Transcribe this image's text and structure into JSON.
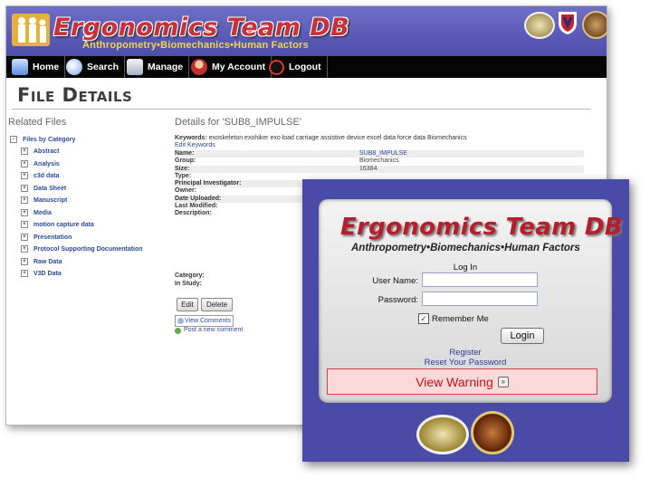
{
  "banner": {
    "title": "Ergonomics Team DB",
    "subtitle": "Anthropometry•Biomechanics•Human Factors"
  },
  "nav": [
    {
      "label": "Home",
      "icon": "home-icon"
    },
    {
      "label": "Search",
      "icon": "search-icon"
    },
    {
      "label": "Manage",
      "icon": "manage-icon"
    },
    {
      "label": "My Account",
      "icon": "account-icon"
    },
    {
      "label": "Logout",
      "icon": "logout-icon"
    }
  ],
  "page": {
    "title": "File Details",
    "related_title": "Related Files",
    "details_title": "Details for 'SUB8_IMPULSE'"
  },
  "tree": {
    "root": "Files by Category",
    "items": [
      "Abstract",
      "Analysis",
      "c3d data",
      "Data Sheet",
      "Manuscript",
      "Media",
      "motion capture data",
      "Presentation",
      "Protocol Supporting Documentation",
      "Raw Data",
      "V3D Data"
    ]
  },
  "details": {
    "keywords_label": "Keywords:",
    "keywords": "exoskeleton exohiker exo load carriage assistive device excel data force data Biomechanics",
    "edit_keywords": "Edit Keywords",
    "rows": [
      {
        "label": "Name:",
        "value": "SUB8_IMPULSE"
      },
      {
        "label": "Group:",
        "value": "Biomechanics"
      },
      {
        "label": "Size:",
        "value": "16384"
      },
      {
        "label": "Type:",
        "value": ""
      },
      {
        "label": "Principal Investigator:",
        "value": ""
      },
      {
        "label": "Owner:",
        "value": ""
      },
      {
        "label": "Date Uploaded:",
        "value": ""
      },
      {
        "label": "Last Modified:",
        "value": ""
      },
      {
        "label": "Description:",
        "value": ""
      }
    ],
    "category_label": "Category:",
    "study_label": "In Study:",
    "edit_button": "Edit",
    "delete_button": "Delete",
    "view_comments": "View Comments",
    "post_comment": "Post a new comment"
  },
  "login": {
    "title": "Ergonomics Team DB",
    "subtitle": "Anthropometry•Biomechanics•Human Factors",
    "heading": "Log In",
    "username_label": "User Name:",
    "username_value": "",
    "password_label": "Password:",
    "password_value": "",
    "remember_label": "Remember Me",
    "remember_checked": "✓",
    "login_button": "Login",
    "register_link": "Register",
    "reset_link": "Reset Your Password",
    "warning": "View Warning",
    "warning_icon": "»"
  },
  "colors": {
    "banner": "#5a5ab8",
    "login_bg": "#4a4aa7",
    "brand_red": "#b51e2a",
    "link": "#2a3f9a"
  }
}
